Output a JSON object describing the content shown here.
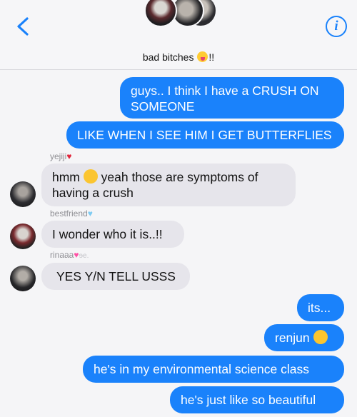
{
  "header": {
    "group_name": "bad bitches",
    "group_suffix": "!!"
  },
  "messages": {
    "m1": "guys.. I think I have a CRUSH ON SOMEONE",
    "m2": "LIKE WHEN I SEE HIM I GET BUTTERFLIES",
    "m3_part1": "hmm",
    "m3_part2": "yeah those are symptoms of having a crush",
    "m4": "I wonder who it is..!!",
    "m5": "YES Y/N TELL USSS",
    "m6": "its...",
    "m7": "renjun",
    "m8": "he's in my environmental science class",
    "m9": "he's just like so beautiful"
  },
  "senders": {
    "s1": "yejiji",
    "s2": "bestfriend",
    "s3": "rinaaa",
    "s3_extra": "ɘe."
  },
  "icons": {
    "back": "chevron-left-icon",
    "info": "info-icon",
    "info_glyph": "i"
  },
  "colors": {
    "accent": "#1a82fb",
    "incoming_bubble": "#e6e5eb"
  }
}
